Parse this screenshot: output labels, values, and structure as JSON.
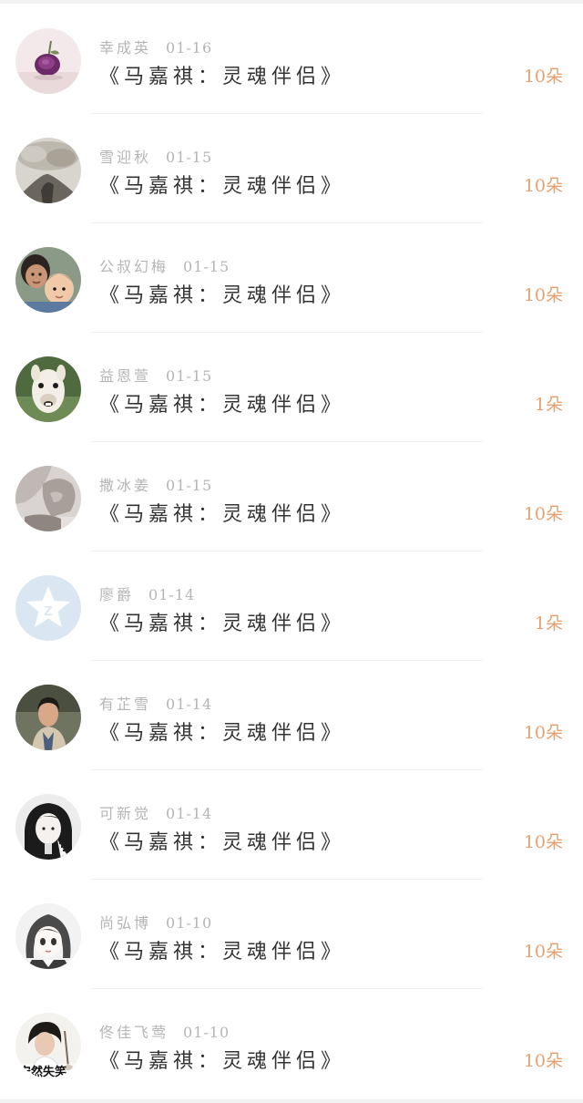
{
  "items": [
    {
      "user": "幸成英",
      "date": "01-16",
      "title": "《马嘉祺：灵魂伴侣》",
      "count": "10朵",
      "avatar_icon": "rose-avatar-icon"
    },
    {
      "user": "雪迎秋",
      "date": "01-15",
      "title": "《马嘉祺：灵魂伴侣》",
      "count": "10朵",
      "avatar_icon": "monochrome-photo-avatar-icon"
    },
    {
      "user": "公叔幻梅",
      "date": "01-15",
      "title": "《马嘉祺：灵魂伴侣》",
      "count": "10朵",
      "avatar_icon": "children-photo-avatar-icon"
    },
    {
      "user": "益恩萱",
      "date": "01-15",
      "title": "《马嘉祺：灵魂伴侣》",
      "count": "1朵",
      "avatar_icon": "alpaca-avatar-icon"
    },
    {
      "user": "撒冰姜",
      "date": "01-15",
      "title": "《马嘉祺：灵魂伴侣》",
      "count": "10朵",
      "avatar_icon": "photo-avatar-icon"
    },
    {
      "user": "廖爵",
      "date": "01-14",
      "title": "《马嘉祺：灵魂伴侣》",
      "count": "1朵",
      "avatar_icon": "default-star-avatar-icon"
    },
    {
      "user": "有芷雪",
      "date": "01-14",
      "title": "《马嘉祺：灵魂伴侣》",
      "count": "10朵",
      "avatar_icon": "man-portrait-avatar-icon"
    },
    {
      "user": "可新觉",
      "date": "01-14",
      "title": "《马嘉祺：灵魂伴侣》",
      "count": "10朵",
      "avatar_icon": "bw-portrait-avatar-icon"
    },
    {
      "user": "尚弘博",
      "date": "01-10",
      "title": "《马嘉祺：灵魂伴侣》",
      "count": "10朵",
      "avatar_icon": "anime-girl-avatar-icon"
    },
    {
      "user": "佟佳飞莺",
      "date": "01-10",
      "title": "《马嘉祺：灵魂伴侣》",
      "count": "10朵",
      "avatar_icon": "woman-portrait-avatar-icon",
      "avatar_caption": "安然失笑"
    }
  ],
  "colors": {
    "meta": "#b5b5b5",
    "title": "#333333",
    "count": "#e8a06e",
    "default_avatar_bg": "#dbe6f3"
  }
}
